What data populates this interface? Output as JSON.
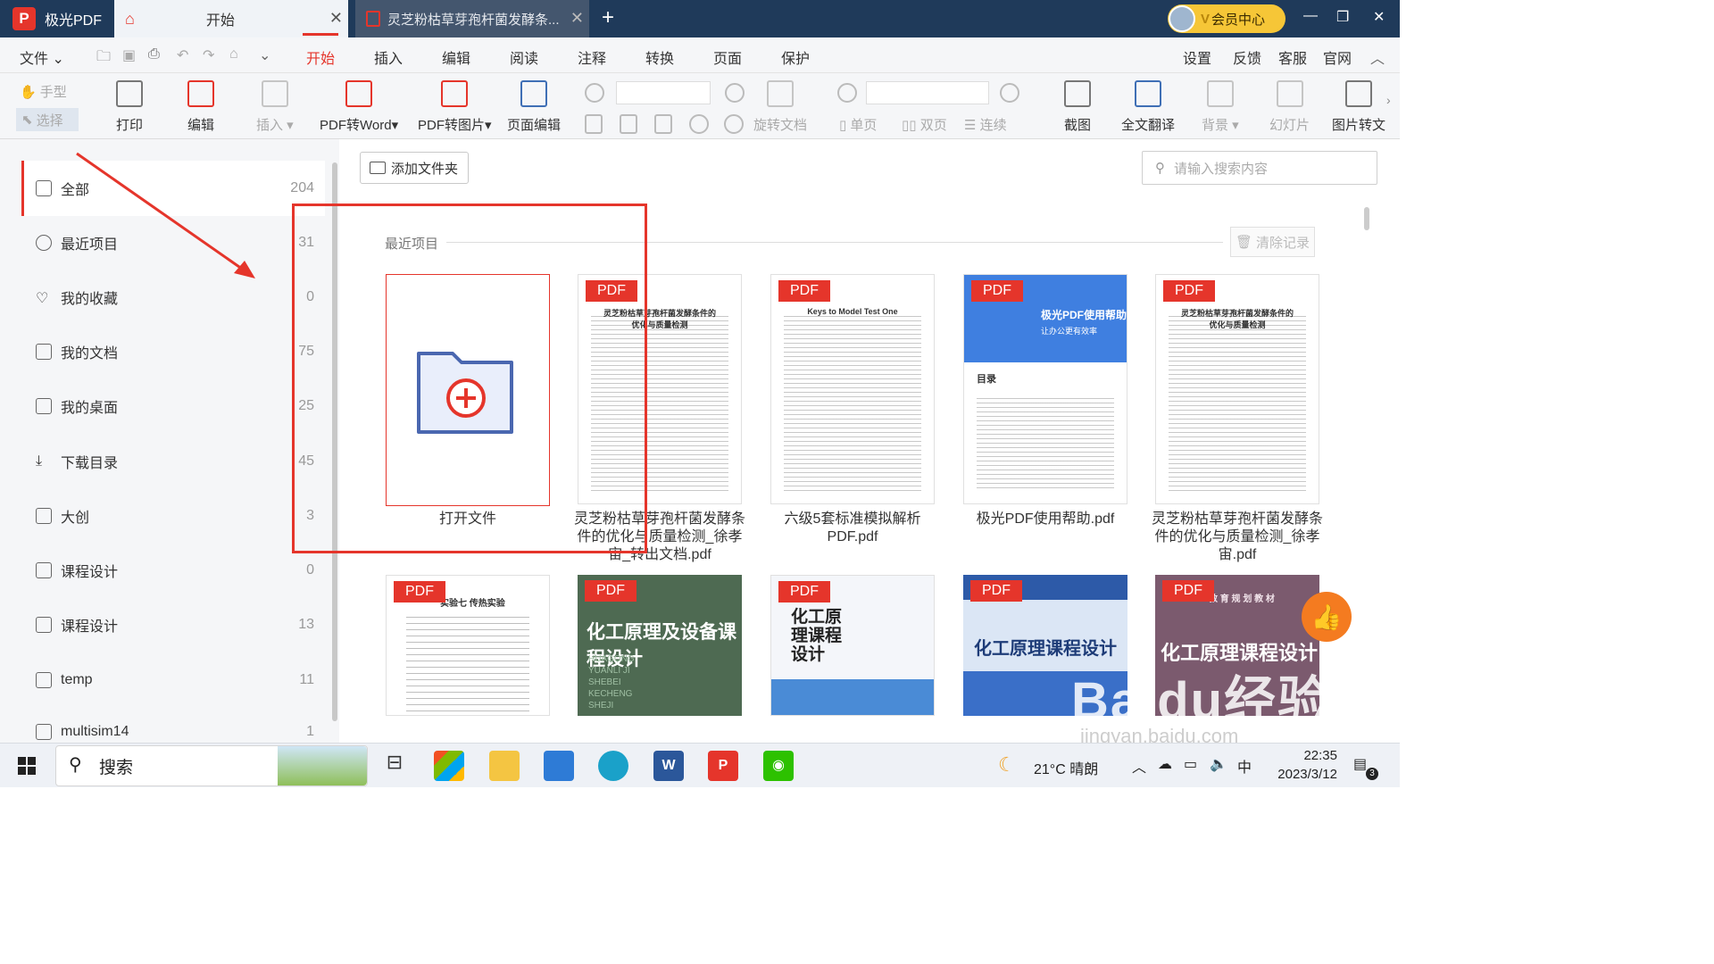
{
  "titlebar": {
    "app_name": "极光PDF",
    "home_tab": "开始",
    "doc_tab": "灵芝粉枯草芽孢杆菌发酵条...",
    "vip_label": "会员中心"
  },
  "menu": {
    "file": "文件",
    "items": [
      "开始",
      "插入",
      "编辑",
      "阅读",
      "注释",
      "转换",
      "页面",
      "保护"
    ],
    "right": [
      "设置",
      "反馈",
      "客服",
      "官网"
    ]
  },
  "toolbar": {
    "hand": "手型",
    "select": "选择",
    "print": "打印",
    "edit": "编辑",
    "insert": "插入",
    "pdf_to_word": "PDF转Word",
    "pdf_to_image": "PDF转图片",
    "page_edit": "页面编辑",
    "rotate_doc": "旋转文档",
    "single": "单页",
    "double": "双页",
    "continuous": "连续",
    "screenshot": "截图",
    "translate": "全文翻译",
    "background": "背景",
    "slideshow": "幻灯片",
    "image_to_text": "图片转文"
  },
  "sidebar": {
    "items": [
      {
        "label": "全部",
        "count": "204"
      },
      {
        "label": "最近项目",
        "count": "31"
      },
      {
        "label": "我的收藏",
        "count": "0"
      },
      {
        "label": "我的文档",
        "count": "75"
      },
      {
        "label": "我的桌面",
        "count": "25"
      },
      {
        "label": "下载目录",
        "count": "45"
      },
      {
        "label": "大创",
        "count": "3"
      },
      {
        "label": "课程设计",
        "count": "0"
      },
      {
        "label": "课程设计",
        "count": "13"
      },
      {
        "label": "temp",
        "count": "11"
      },
      {
        "label": "multisim14",
        "count": "1"
      }
    ]
  },
  "main": {
    "add_folder": "添加文件夹",
    "search_placeholder": "请输入搜索内容",
    "recent_label": "最近项目",
    "clear_label": "清除记录",
    "open_file": "打开文件",
    "badge": "PDF",
    "files": [
      {
        "name": "灵芝粉枯草芽孢杆菌发酵条件的优化与质量检测_徐孝宙_转出文档.pdf",
        "title": "灵芝粉枯草芽孢杆菌发酵条件的优化与质量检测"
      },
      {
        "name": "六级5套标准模拟解析PDF.pdf",
        "title": "Keys to Model Test One"
      },
      {
        "name": "极光PDF使用帮助.pdf",
        "title": "极光PDF使用帮助",
        "subtitle": "让办公更有效率",
        "toc": "目录"
      },
      {
        "name": "灵芝粉枯草芽孢杆菌发酵条件的优化与质量检测_徐孝宙.pdf",
        "title": "灵芝粉枯草芽孢杆菌发酵条件的优化与质量检测"
      }
    ],
    "row2": [
      {
        "title": "实验七 传热实验"
      },
      {
        "title": "化工原理及设备课程设计",
        "pinyin": "HUAGONG YUANLI JI SHEBEI KECHENG SHEJI"
      },
      {
        "title": "化工原理课程设计"
      },
      {
        "title": "化工原理课程设计"
      },
      {
        "title": "化工原理课程设计",
        "top": "教 育 规 划 教 材"
      }
    ]
  },
  "watermark": {
    "logo": "Baidu经验",
    "url": "jingyan.baidu.com"
  },
  "taskbar": {
    "search": "搜索",
    "temperature": "21°C  晴朗",
    "ime": "中",
    "time": "22:35",
    "date": "2023/3/12",
    "notif": "3"
  },
  "colors": {
    "accent": "#e5352b",
    "titlebar": "#1f3a5a",
    "vip": "#f6c637"
  }
}
